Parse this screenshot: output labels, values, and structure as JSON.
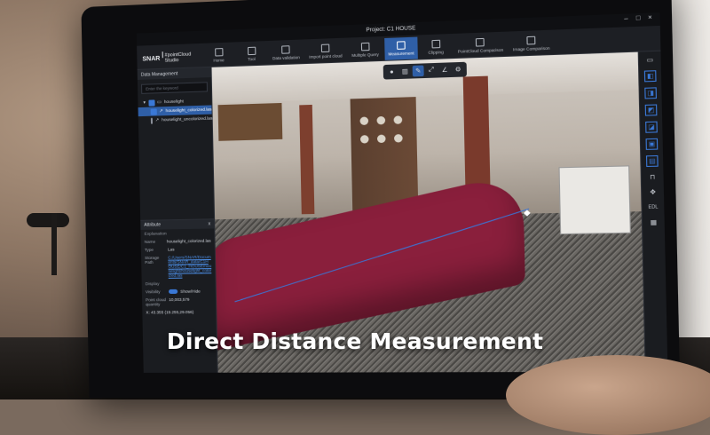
{
  "window": {
    "title": "Project: C1 HOUSE",
    "logo_brand": "SNAR",
    "logo_product": "#pointCloud Studio"
  },
  "toolbar": {
    "tools": [
      {
        "label": "Home"
      },
      {
        "label": "Tool"
      },
      {
        "label": "Data validation"
      },
      {
        "label": "Import point cloud"
      },
      {
        "label": "Multiple Query"
      },
      {
        "label": "Measurement"
      },
      {
        "label": "Clipping"
      },
      {
        "label": "PointCloud Comparison"
      },
      {
        "label": "Image Comparison"
      }
    ],
    "active_index": 5
  },
  "data_panel": {
    "title": "Data Management",
    "search_placeholder": "Enter the keyword",
    "items": [
      {
        "label": "houselight",
        "checked": true,
        "level": 0
      },
      {
        "label": "houselight_colorized.las",
        "checked": true,
        "level": 1,
        "selected": true
      },
      {
        "label": "houselight_uncolorized.las",
        "checked": false,
        "level": 1
      }
    ]
  },
  "attributes": {
    "title": "Attribute",
    "close": "x",
    "section_explanation": "Explanation",
    "name_label": "Name",
    "name_value": "houselight_colorized.las",
    "type_label": "Type",
    "type_value": "Las",
    "storage_label": "Storage Path",
    "storage_value": "C:/Users/SNAR/Documents/SNAR_data/C1HOUSE/C1_HOUSE/houselight/houselight_colorized.las",
    "section_display": "Display",
    "visibility_label": "Visibility",
    "visibility_value": "Show/Hide",
    "quantity_label": "Point cloud quantity",
    "quantity_value": "10,003,579",
    "extra_value": "X: 43.355 (19.255,29.056)"
  },
  "viewport_toolbar": [
    "pin-icon",
    "columns-icon",
    "pencil-icon",
    "expand-icon",
    "angle-icon",
    "gear-icon"
  ],
  "right_tools": [
    "folder-icon",
    "cube-top-icon",
    "cube-front-icon",
    "cube-left-icon",
    "cube-right-icon",
    "cube-back-icon",
    "cube-bottom-icon",
    "lock-icon",
    "move-icon",
    "EDL",
    "grid-icon"
  ],
  "caption": "Direct Distance Measurement"
}
